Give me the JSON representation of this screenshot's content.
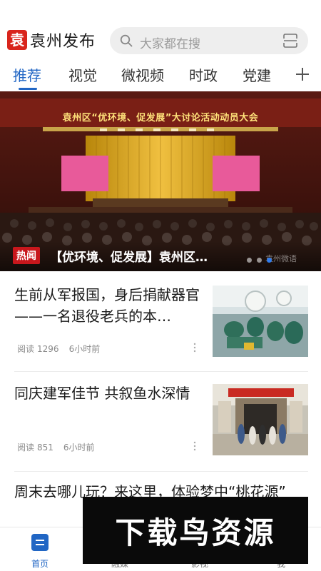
{
  "header": {
    "app_title": "袁州发布",
    "logo_glyph": "袁",
    "search_placeholder": "大家都在搜",
    "brand_color": "#d9251c"
  },
  "tabs": [
    {
      "label": "推荐",
      "active": true
    },
    {
      "label": "视觉",
      "active": false
    },
    {
      "label": "微视频",
      "active": false
    },
    {
      "label": "时政",
      "active": false
    },
    {
      "label": "党建",
      "active": false
    }
  ],
  "accent_color": "#2166c4",
  "hero": {
    "banner_text": "袁州区“优环境、促发展”大讨论活动动员大会",
    "badge": "热闻",
    "title": "【优环境、促发展】袁州区…",
    "watermark": "袁州微语",
    "slides": 3,
    "active_slide": 2
  },
  "articles": [
    {
      "title": "生前从军报国，身后捐献器官——一名退役老兵的本…",
      "reads_label": "阅读",
      "reads": "1296",
      "time": "6小时前"
    },
    {
      "title": "同庆建军佳节 共叙鱼水深情",
      "reads_label": "阅读",
      "reads": "851",
      "time": "6小时前"
    },
    {
      "title": "周末去哪儿玩？来这里，体验梦中“桃花源”"
    }
  ],
  "bottom_nav": [
    {
      "label": "首页",
      "active": true
    },
    {
      "label": "融媒",
      "active": false
    },
    {
      "label": "影视",
      "active": false
    },
    {
      "label": "我",
      "active": false
    }
  ],
  "overlay_watermark": "下载鸟资源"
}
